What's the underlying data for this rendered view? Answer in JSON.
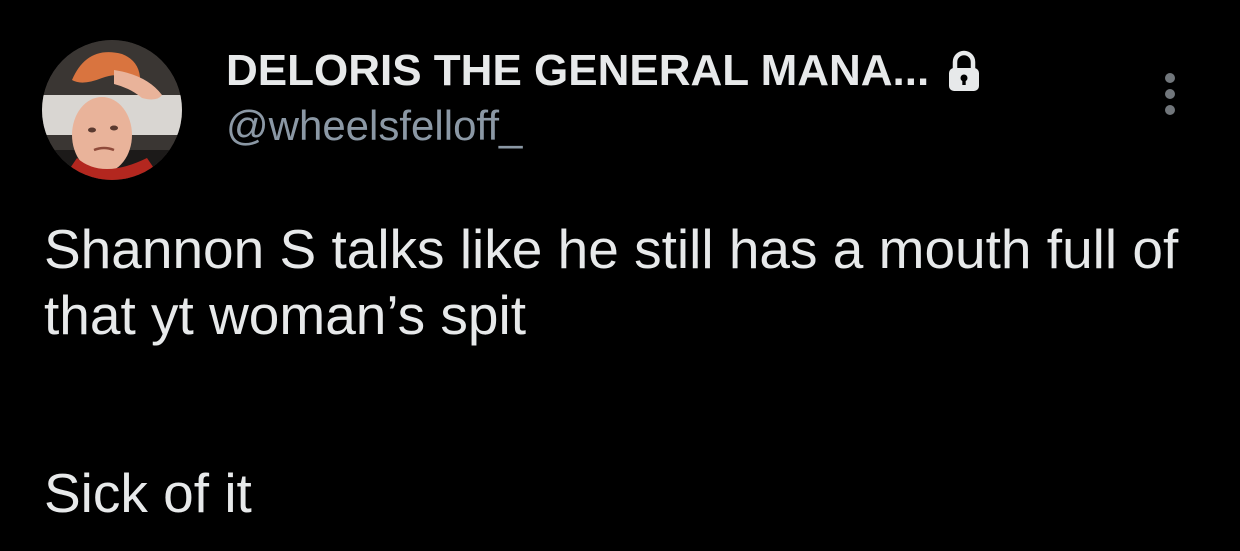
{
  "author": {
    "display_name": "DELORIS THE GENERAL MANA...",
    "handle": "@wheelsfelloff_",
    "avatar_icon": "user-avatar-photo",
    "protected_icon": "lock-icon"
  },
  "menu": {
    "more_icon": "more-vertical-icon"
  },
  "tweet": {
    "text_para1": "Shannon S talks like he still has a mouth full of that yt woman’s spit",
    "text_para2": "Sick of it"
  },
  "colors": {
    "background": "#000000",
    "primary_text": "#e7e9ea",
    "secondary_text": "#8b98a5"
  }
}
